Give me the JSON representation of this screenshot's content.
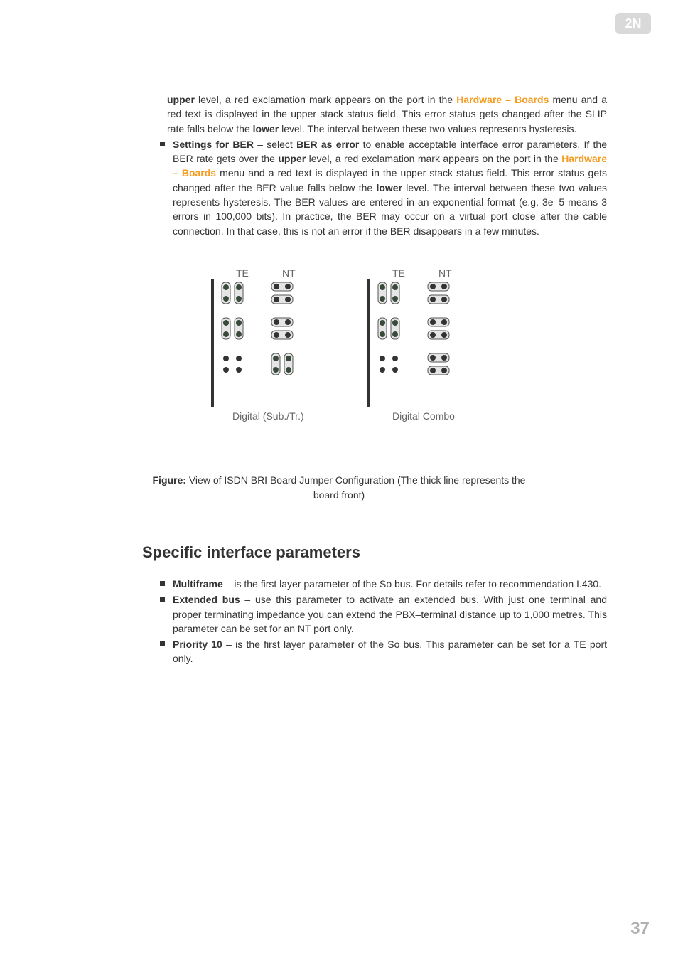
{
  "logo_text": "2N",
  "para1": {
    "pre_bold": "upper",
    "t1": " level, a red exclamation mark appears on the port in the ",
    "link1": "Hardware – Boards",
    "t2": " menu and a red text is displayed in the upper stack status field. This error status gets changed after the SLIP rate falls below the ",
    "b2": "lower",
    "t3": " level. The interval between these two values represents hysteresis."
  },
  "bullet1": {
    "b1": "Settings for BER",
    "t1": " – select ",
    "b2": "BER as error",
    "t2": " to enable acceptable interface error parameters. If the BER rate gets over the ",
    "b3": "upper",
    "t3": " level, a red exclamation mark appears on the port in the ",
    "link1": "Hardware – Boards",
    "t4": " menu and a red text is displayed in the upper stack status field. This error status gets changed after the BER value falls below the ",
    "b4": "lower",
    "t5": " level. The interval between these two values represents hysteresis. The BER values are entered in an exponential format (e.g. 3e–5 means 3 errors in 100,000 bits). In practice, the BER may occur on a virtual port close after the cable connection. In that case, this is not an error if the BER disappears in a few minutes."
  },
  "diagram": {
    "te": "TE",
    "nt": "NT",
    "left_caption": "Digital (Sub./Tr.)",
    "right_caption": "Digital Combo"
  },
  "figure": {
    "b": "Figure:",
    "t": " View of ISDN BRI Board Jumper Configuration (The thick line represents the board front)"
  },
  "section_title": "Specific interface parameters",
  "list2": {
    "i1": {
      "b": "Multiframe",
      "t": " – is the first layer parameter of the So bus. For details refer to recommendation I.430."
    },
    "i2": {
      "b": "Extended bus",
      "t": " – use this parameter to activate an extended bus. With just one terminal and proper terminating impedance you can extend the PBX–terminal distance up to 1,000 metres. This parameter can be set for an NT port only."
    },
    "i3": {
      "b": "Priority 10",
      "t": " – is the first layer parameter of the So bus. This parameter can be set for a TE port only."
    }
  },
  "page_number": "37"
}
